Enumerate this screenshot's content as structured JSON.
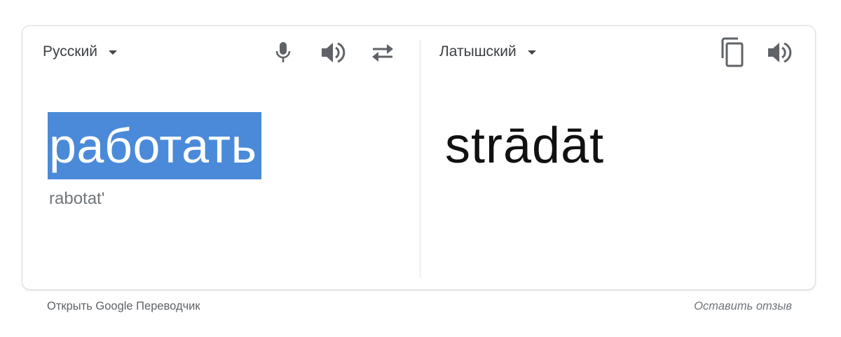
{
  "source": {
    "language": "Русский",
    "text": "работать",
    "transliteration": "rabotat'"
  },
  "target": {
    "language": "Латышский",
    "text": "strādāt"
  },
  "toolbar": {
    "icons": [
      "microphone-icon",
      "speaker-icon",
      "swap-icon",
      "copy-icon",
      "speaker-icon"
    ]
  },
  "footer": {
    "open_link": "Открыть Google Переводчик",
    "feedback_link": "Оставить отзыв"
  },
  "colors": {
    "selection": "#4a8ad9",
    "icon": "#5f6368"
  }
}
